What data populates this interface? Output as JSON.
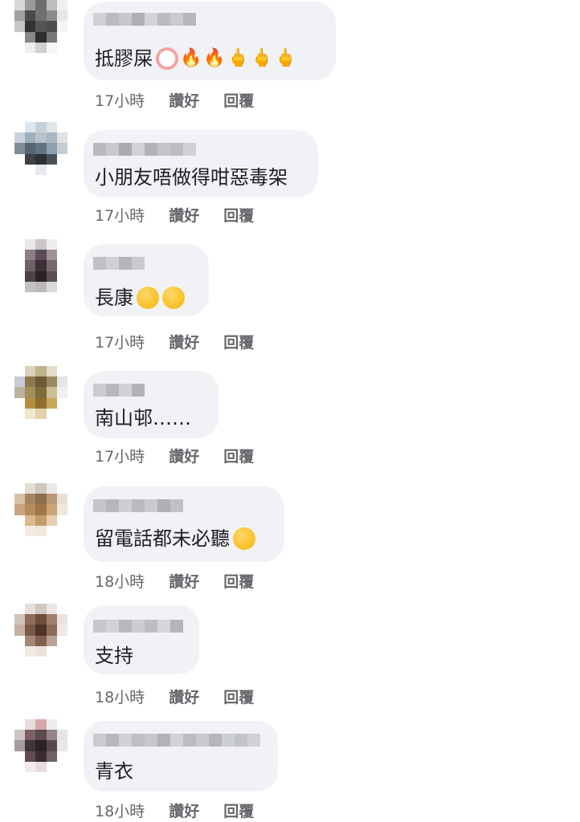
{
  "comments": [
    {
      "text": "抵膠屎",
      "emojis": [
        "clown-emoji",
        "fire-emoji",
        "fire-emoji",
        "middle-finger-emoji",
        "middle-finger-emoji",
        "middle-finger-emoji"
      ],
      "time": "17小時",
      "like": "讚好",
      "reply": "回覆"
    },
    {
      "text": "小朋友唔做得咁惡毒架",
      "emojis": [],
      "time": "17小時",
      "like": "讚好",
      "reply": "回覆"
    },
    {
      "text": "長康",
      "emojis": [
        "hand-over-mouth-emoji",
        "hand-over-mouth-emoji"
      ],
      "time": "17小時",
      "like": "讚好",
      "reply": "回覆"
    },
    {
      "text": "南山邨……",
      "emojis": [],
      "time": "17小時",
      "like": "讚好",
      "reply": "回覆"
    },
    {
      "text": "留電話都未必聽",
      "emojis": [
        "tears-of-joy-emoji"
      ],
      "time": "18小時",
      "like": "讚好",
      "reply": "回覆"
    },
    {
      "text": "支持",
      "emojis": [],
      "time": "18小時",
      "like": "讚好",
      "reply": "回覆"
    },
    {
      "text": "青衣",
      "emojis": [],
      "time": "18小時",
      "like": "讚好",
      "reply": "回覆"
    }
  ],
  "colors": {
    "bubble": "#f0f2f5",
    "meta_text": "#65676b",
    "body_text": "#1c1e21"
  }
}
